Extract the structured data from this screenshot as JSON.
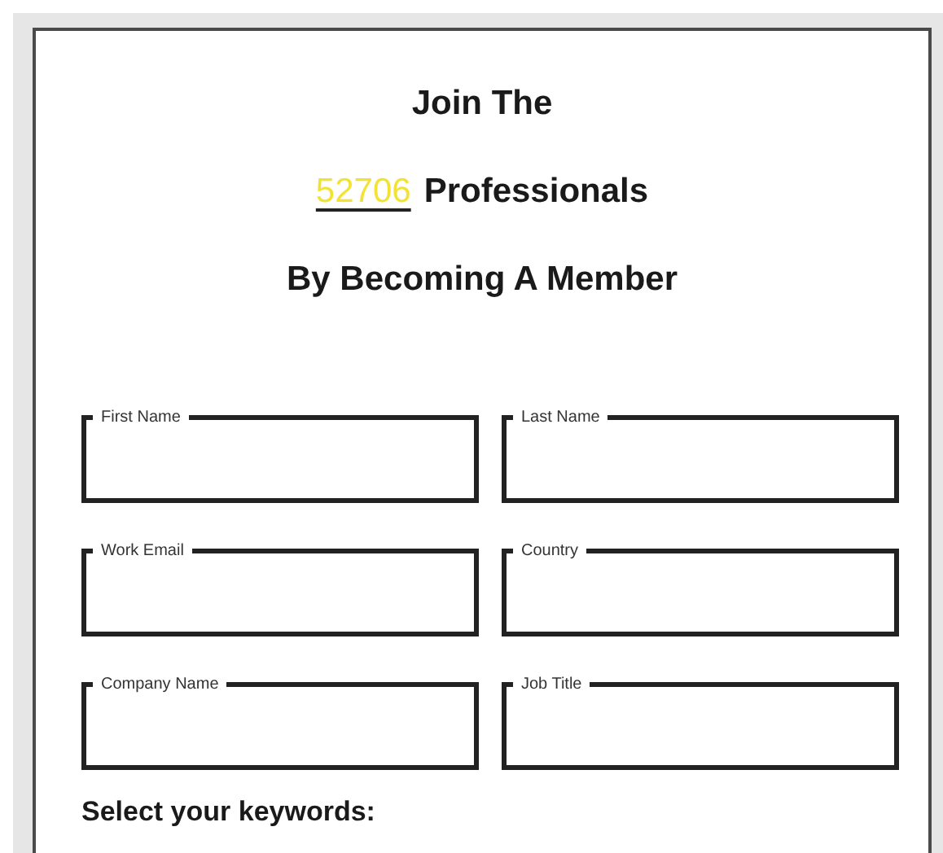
{
  "heading": {
    "line_1": "Join The",
    "member_count": "52706",
    "line_2": "Professionals",
    "line_3": "By Becoming A Member"
  },
  "fields": [
    {
      "label": "First Name"
    },
    {
      "label": "Last Name"
    },
    {
      "label": "Work Email"
    },
    {
      "label": "Country"
    },
    {
      "label": "Company Name"
    },
    {
      "label": "Job Title"
    }
  ],
  "keywords_heading": "Select your keywords:"
}
